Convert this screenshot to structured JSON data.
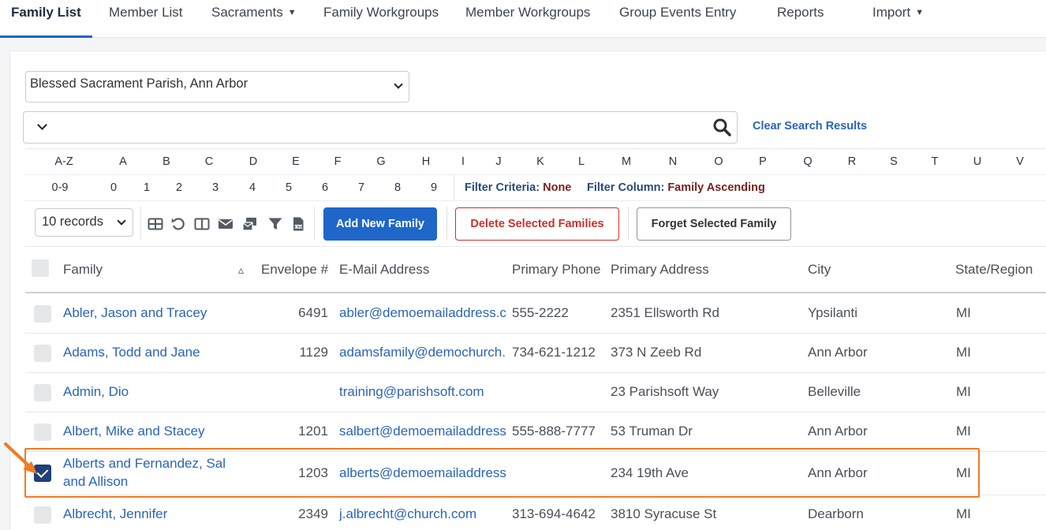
{
  "nav": {
    "tabs": [
      {
        "label": "Family List",
        "active": true
      },
      {
        "label": "Member List"
      },
      {
        "label": "Sacraments",
        "dropdown": true
      },
      {
        "label": "Family Workgroups"
      },
      {
        "label": "Member Workgroups"
      },
      {
        "label": "Group Events Entry"
      },
      {
        "label": "Reports"
      },
      {
        "label": "Import",
        "dropdown": true
      }
    ]
  },
  "parish_select": {
    "value": "Blessed Sacrament Parish, Ann Arbor"
  },
  "search": {
    "clear_label": "Clear Search Results"
  },
  "alpha_filter": {
    "letters": [
      "A-Z",
      "A",
      "B",
      "C",
      "D",
      "E",
      "F",
      "G",
      "H",
      "I",
      "J",
      "K",
      "L",
      "M",
      "N",
      "O",
      "P",
      "Q",
      "R",
      "S",
      "T",
      "U",
      "V"
    ],
    "digits": [
      "0-9",
      "0",
      "1",
      "2",
      "3",
      "4",
      "5",
      "6",
      "7",
      "8",
      "9"
    ],
    "filter_criteria_label": "Filter Criteria:",
    "filter_criteria_value": "None",
    "filter_column_label": "Filter Column:",
    "filter_column_value": "Family Ascending"
  },
  "toolbar": {
    "records_value": "10 records",
    "icons": [
      "table-view-icon",
      "reset-icon",
      "columns-icon",
      "email-icon",
      "mail-merge-icon",
      "filter-icon",
      "csv-export-icon"
    ],
    "add_label": "Add New Family",
    "delete_label": "Delete Selected Families",
    "forget_label": "Forget Selected Family"
  },
  "table": {
    "columns": [
      "Family",
      "Envelope #",
      "E-Mail Address",
      "Primary Phone",
      "Primary Address",
      "City",
      "State/Region"
    ],
    "sort_indicator": "▵",
    "rows": [
      {
        "family": "Abler, Jason and Tracey",
        "envelope": "6491",
        "email": "abler@demoemailaddress.c",
        "phone": "555-2222",
        "address": "2351 Ellsworth Rd",
        "city": "Ypsilanti",
        "state": "MI",
        "checked": false
      },
      {
        "family": "Adams, Todd and Jane",
        "envelope": "1129",
        "email": "adamsfamily@demochurch.",
        "phone": "734-621-1212",
        "address": "373 N Zeeb Rd",
        "city": "Ann Arbor",
        "state": "MI",
        "checked": false
      },
      {
        "family": "Admin, Dio",
        "envelope": "",
        "email": "training@parishsoft.com",
        "phone": "",
        "address": "23 Parishsoft Way",
        "city": "Belleville",
        "state": "MI",
        "checked": false
      },
      {
        "family": "Albert, Mike and Stacey",
        "envelope": "1201",
        "email": "salbert@demoemailaddress",
        "phone": "555-888-7777",
        "address": "53 Truman Dr",
        "city": "Ann Arbor",
        "state": "MI",
        "checked": false
      },
      {
        "family": "Alberts and Fernandez, Sal and Allison",
        "envelope": "1203",
        "email": "alberts@demoemailaddress",
        "phone": "",
        "address": "234 19th Ave",
        "city": "Ann Arbor",
        "state": "MI",
        "checked": true
      },
      {
        "family": "Albrecht, Jennifer",
        "envelope": "2349",
        "email": "j.albrecht@church.com",
        "phone": "313-694-4642",
        "address": "3810 Syracuse St",
        "city": "Dearborn",
        "state": "MI",
        "checked": false
      }
    ]
  },
  "colors": {
    "primary": "#1f66c9",
    "danger": "#c9302c",
    "link": "#2a64b8",
    "highlight": "#f07a24",
    "checked": "#1f3f7a"
  }
}
